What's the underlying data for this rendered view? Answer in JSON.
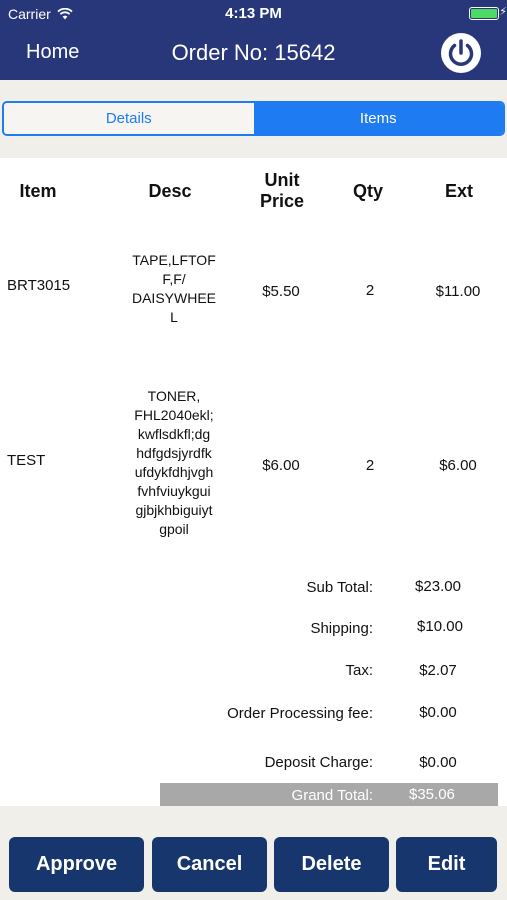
{
  "status_bar": {
    "carrier": "Carrier",
    "time": "4:13 PM",
    "battery_color": "#4cd964"
  },
  "nav": {
    "home_label": "Home",
    "title": "Order No: 15642",
    "power_icon": "power-icon",
    "background": "#28377a"
  },
  "tabs": [
    {
      "label": "Details",
      "selected": false
    },
    {
      "label": "Items",
      "selected": true
    }
  ],
  "table": {
    "headers": {
      "item": "Item",
      "desc": "Desc",
      "unit_price_line1": "Unit",
      "unit_price_line2": "Price",
      "qty": "Qty",
      "ext": "Ext"
    },
    "rows": [
      {
        "item": "BRT3015",
        "desc_lines": [
          "TAPE,LFTOF",
          "F,F/",
          "DAISYWHEE",
          "L"
        ],
        "unit_price": "$5.50",
        "qty": "2",
        "ext": "$11.00"
      },
      {
        "item": "TEST",
        "desc_lines": [
          "TONER,",
          "FHL2040ekl;",
          "kwflsdkfl;dg",
          "hdfgdsjyrdfk",
          "ufdykfdhjvgh",
          "fvhfviuykgui",
          "gjbjkhbiguiyt",
          "gpoil"
        ],
        "unit_price": "$6.00",
        "qty": "2",
        "ext": "$6.00"
      }
    ]
  },
  "summary": {
    "sub_total_label": "Sub Total:",
    "sub_total": "$23.00",
    "shipping_label": "Shipping:",
    "shipping": "$10.00",
    "tax_label": "Tax:",
    "tax": "$2.07",
    "processing_label": "Order Processing fee:",
    "processing": "$0.00",
    "deposit_label": "Deposit Charge:",
    "deposit": "$0.00",
    "grand_total_label": "Grand Total:",
    "grand_total": "$35.06"
  },
  "actions": {
    "approve": "Approve",
    "cancel": "Cancel",
    "delete": "Delete",
    "edit": "Edit",
    "button_color": "#17366d"
  }
}
